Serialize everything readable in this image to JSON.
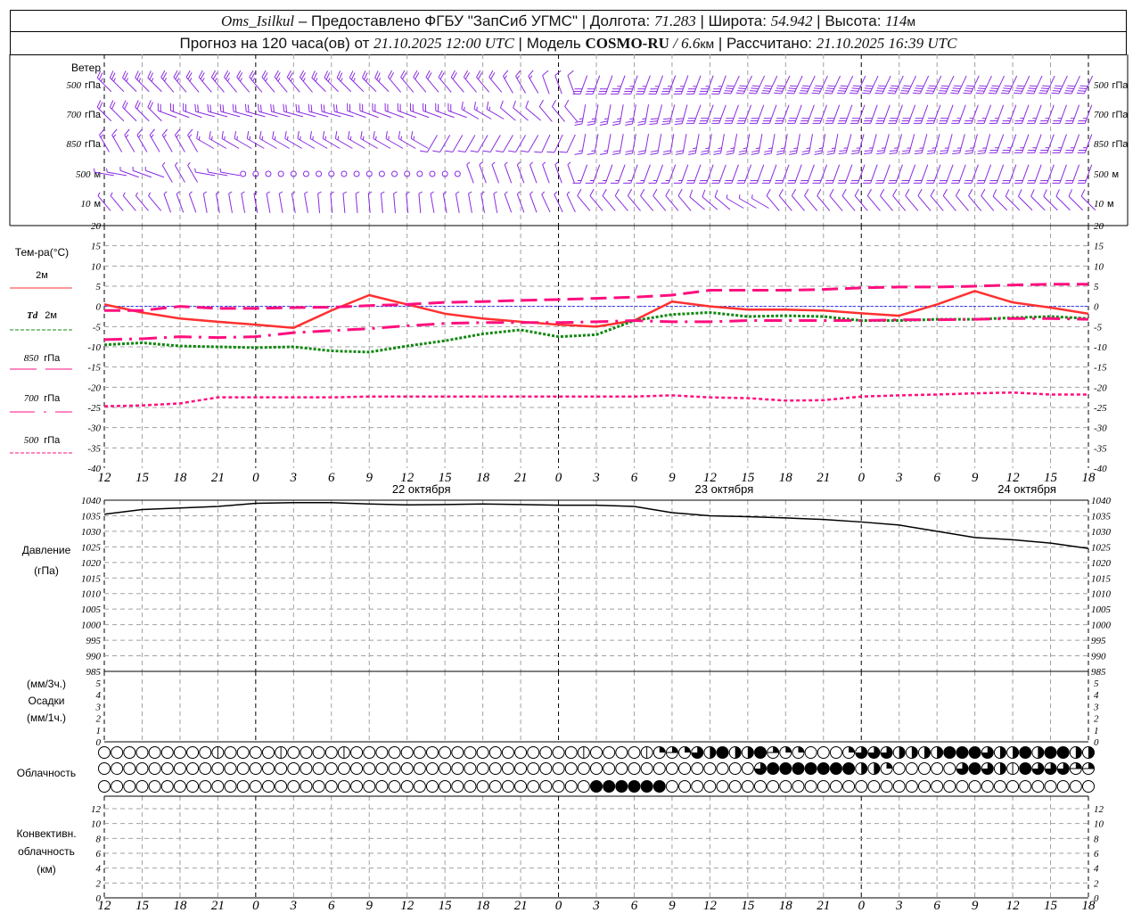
{
  "header": {
    "station": "Oms_Isilkul",
    "provided": " – Предоставлено ФГБУ \"ЗапСиб УГМС\" | Долгота: ",
    "lon": "71.283",
    "lat_label": " | Широта: ",
    "lat": "54.942",
    "alt_label": " | Высота: ",
    "alt": "114",
    "alt_unit": "м",
    "forecast_label": "Прогноз на 120 часа(ов) от ",
    "forecast_start": "21.10.2025 12:00 UTC",
    "model_label": " | Модель ",
    "model": "COSMO-RU",
    "resolution_sep": " / ",
    "resolution": "6.6",
    "resolution_unit": "км",
    "computed_label": " | Рассчитано: ",
    "computed": "21.10.2025 16:39 UTC"
  },
  "colors": {
    "wind": "#8a2be2",
    "t2m": "#ff3030",
    "td2m": "#118811",
    "t850": "#ff0f7f",
    "t700": "#ff0f7f",
    "t500": "#ff0f7f",
    "zero_line": "#3030ff",
    "pressure": "#000000",
    "grid": "#a0a0a0"
  },
  "time_axis": {
    "hour_labels": [
      "12",
      "15",
      "18",
      "21",
      "0",
      "3",
      "6",
      "9",
      "12",
      "15",
      "18",
      "21",
      "0",
      "3",
      "6",
      "9",
      "12",
      "15",
      "18",
      "21",
      "0",
      "3",
      "6",
      "9",
      "12",
      "15",
      "18"
    ],
    "date_labels": [
      {
        "text": "22 октября",
        "at_hour_index": 8
      },
      {
        "text": "23 октября",
        "at_hour_index": 16
      },
      {
        "text": "24 октября",
        "at_hour_index": 24
      }
    ],
    "midnight_indices": [
      4,
      12,
      20
    ]
  },
  "wind": {
    "title": "Ветер",
    "levels": [
      {
        "label_num": "500",
        "label_unit": "гПа",
        "dir": [
          315,
          315,
          320,
          320,
          320,
          320,
          315,
          315,
          320,
          320,
          320,
          330,
          340,
          200,
          200,
          200,
          200,
          205,
          205,
          205,
          205,
          205,
          205,
          205,
          205,
          205,
          205
        ],
        "spd": [
          12,
          12,
          12,
          12,
          12,
          12,
          12,
          12,
          10,
          10,
          10,
          8,
          6,
          15,
          17,
          18,
          18,
          20,
          20,
          20,
          20,
          20,
          20,
          20,
          20,
          20,
          20
        ]
      },
      {
        "label_num": "700",
        "label_unit": "гПа",
        "dir": [
          315,
          315,
          290,
          285,
          285,
          285,
          285,
          290,
          290,
          290,
          300,
          310,
          320,
          190,
          190,
          195,
          200,
          200,
          200,
          200,
          200,
          200,
          200,
          200,
          200,
          200,
          200
        ],
        "spd": [
          10,
          10,
          10,
          10,
          10,
          10,
          10,
          10,
          10,
          10,
          8,
          6,
          5,
          12,
          14,
          15,
          15,
          15,
          15,
          15,
          15,
          15,
          15,
          14,
          12,
          12,
          12
        ]
      },
      {
        "label_num": "850",
        "label_unit": "гПа",
        "dir": [
          330,
          330,
          330,
          300,
          300,
          300,
          300,
          300,
          300,
          210,
          210,
          210,
          205,
          190,
          190,
          190,
          190,
          190,
          190,
          190,
          195,
          195,
          195,
          195,
          200,
          200,
          200
        ],
        "spd": [
          8,
          8,
          8,
          9,
          9,
          9,
          9,
          9,
          9,
          5,
          5,
          6,
          6,
          9,
          10,
          11,
          12,
          12,
          12,
          12,
          12,
          12,
          12,
          12,
          12,
          12,
          12
        ]
      },
      {
        "label_num": "500",
        "label_unit": "м",
        "dir": [
          280,
          290,
          330,
          280,
          0,
          0,
          0,
          0,
          0,
          0,
          340,
          340,
          340,
          200,
          200,
          200,
          200,
          200,
          200,
          200,
          200,
          200,
          200,
          200,
          200,
          200,
          200
        ],
        "spd": [
          4,
          4,
          4,
          3,
          0,
          0,
          0,
          0,
          0,
          0,
          4,
          4,
          4,
          7,
          8,
          9,
          10,
          10,
          10,
          10,
          10,
          10,
          10,
          10,
          10,
          10,
          10
        ]
      },
      {
        "label_num": "10",
        "label_unit": "м",
        "dir": [
          320,
          320,
          340,
          350,
          350,
          350,
          355,
          355,
          355,
          350,
          350,
          340,
          335,
          320,
          320,
          320,
          310,
          300,
          320,
          320,
          320,
          320,
          320,
          320,
          315,
          315,
          315
        ],
        "spd": [
          3,
          4,
          4,
          4,
          4,
          4,
          4,
          4,
          4,
          4,
          4,
          4,
          4,
          5,
          5,
          5,
          5,
          4,
          5,
          5,
          5,
          5,
          5,
          5,
          5,
          5,
          5
        ]
      }
    ]
  },
  "chart_data": [
    {
      "type": "line",
      "ylabel": "Тем-ра(°C)",
      "ylim": [
        -40,
        20
      ],
      "yticks": [
        "20",
        "15",
        "10",
        "5",
        "0",
        "-5",
        "-10",
        "-15",
        "-20",
        "-25",
        "-30",
        "-35",
        "-40"
      ],
      "grid": true,
      "series": [
        {
          "name": "2м",
          "values": [
            0.5,
            -1.5,
            -3,
            -3.8,
            -4.5,
            -5.3,
            -1,
            2.8,
            0.5,
            -1.8,
            -3,
            -3.8,
            -4.5,
            -5,
            -3.5,
            1.2,
            0,
            -0.8,
            -0.8,
            -1,
            -1.7,
            -2.3,
            0.5,
            3.8,
            1,
            -0.3,
            -1.8
          ]
        },
        {
          "name": "Td 2м",
          "name_italic": "Td",
          "name_rest": "2м",
          "values": [
            -9.5,
            -9,
            -9.8,
            -10,
            -10.2,
            -10,
            -11,
            -11.3,
            -9.8,
            -8.5,
            -6.8,
            -5.8,
            -7.5,
            -7,
            -3.5,
            -2,
            -1.5,
            -2.5,
            -2.3,
            -2.5,
            -3.5,
            -3.5,
            -3.2,
            -3.2,
            -2.8,
            -2.5,
            -3
          ]
        },
        {
          "name": "850 гПа",
          "name_num": "850",
          "name_unit": "гПа",
          "values": [
            -1,
            -1,
            0,
            -0.5,
            -0.5,
            -0.3,
            -0.2,
            0.2,
            0.5,
            1,
            1.2,
            1.5,
            1.7,
            2,
            2.3,
            2.8,
            4,
            4,
            4,
            4.2,
            4.6,
            4.8,
            4.8,
            5,
            5.3,
            5.5,
            5.5
          ]
        },
        {
          "name": "700 гПа",
          "name_num": "700",
          "name_unit": "гПа",
          "values": [
            -8.2,
            -8,
            -7.5,
            -7.7,
            -7.5,
            -6.5,
            -6,
            -5.5,
            -4.8,
            -4.2,
            -4,
            -4,
            -4,
            -3.8,
            -3.5,
            -3.8,
            -3.8,
            -3.5,
            -3.5,
            -3.5,
            -3.5,
            -3.3,
            -3.3,
            -3.2,
            -3,
            -3,
            -3.2
          ]
        },
        {
          "name": "500 гПа",
          "name_num": "500",
          "name_unit": "гПа",
          "values": [
            -24.7,
            -24.5,
            -24,
            -22.5,
            -22.5,
            -22.5,
            -22.5,
            -22.3,
            -22.3,
            -22.3,
            -22.3,
            -22.3,
            -22.3,
            -22.3,
            -22.3,
            -22,
            -22.5,
            -22.7,
            -23.3,
            -23.2,
            -22.3,
            -22,
            -21.8,
            -21.5,
            -21.3,
            -21.8,
            -21.8
          ]
        }
      ]
    },
    {
      "type": "line",
      "ylabel": "Давление",
      "yunit": "(гПа)",
      "ylim": [
        985,
        1040
      ],
      "yticks": [
        "1040",
        "1035",
        "1030",
        "1025",
        "1020",
        "1015",
        "1010",
        "1005",
        "1000",
        "995",
        "990",
        "985"
      ],
      "grid": true,
      "series": [
        {
          "values": [
            1035.5,
            1037,
            1037.5,
            1038,
            1039,
            1039.2,
            1039.2,
            1038.8,
            1038.5,
            1038.6,
            1038.8,
            1038.6,
            1038.4,
            1038.4,
            1038,
            1036,
            1035,
            1034.7,
            1034.3,
            1033.8,
            1033,
            1032,
            1030,
            1028,
            1027.3,
            1026.2,
            1024.5
          ]
        }
      ]
    },
    {
      "type": "bar",
      "ylabel_top": "(мм/3ч.)",
      "ylabel": "Осадки",
      "ylabel_bottom": "(мм/1ч.)",
      "ylim": [
        0,
        5
      ],
      "yticks": [
        "5",
        "4",
        "3",
        "2",
        "1",
        "0"
      ],
      "values": []
    },
    {
      "type": "table",
      "label": "Облачность",
      "encoding": "octas per hour, 3 layers",
      "rows": [
        "0000000001000010000100000000000000000010000123264844832200026664444888644848844",
        "0000000000000000000000000000000000000000000000000000688888884420000068641866633",
        "0000000000000000000000000000000000000008888880000000000000000000000000000000000"
      ]
    },
    {
      "type": "bar",
      "ylabel": "Конвективн.",
      "ylabel2": "облачность",
      "yunit": "(км)",
      "ylim": [
        0,
        13
      ],
      "yticks": [
        "12",
        "10",
        "8",
        "6",
        "4",
        "2",
        "0"
      ],
      "values": []
    }
  ]
}
